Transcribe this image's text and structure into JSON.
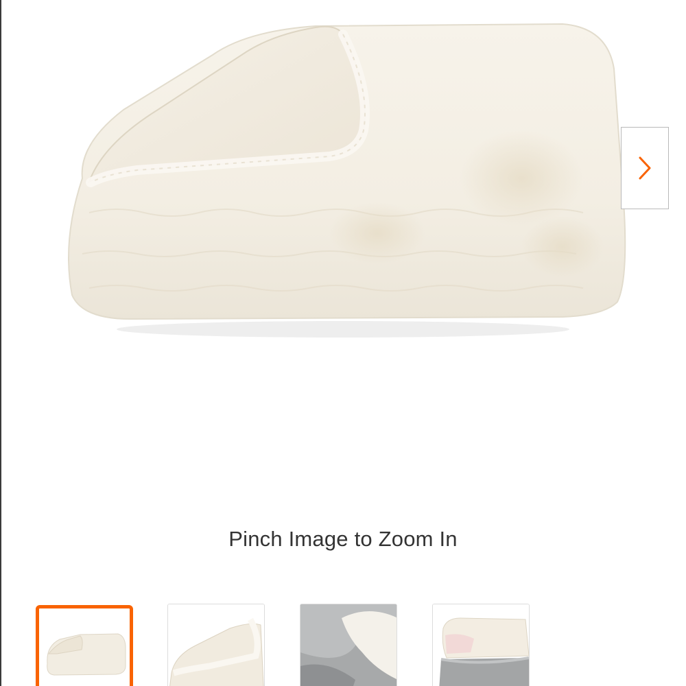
{
  "product_image": {
    "alt_subject": "blanket-image",
    "accent_color": "#f96302"
  },
  "carousel": {
    "next_icon": "chevron-right-icon"
  },
  "zoom_hint": "Pinch Image to Zoom In",
  "thumbnails": [
    {
      "name": "thumbnail-folded-blanket",
      "selected": true
    },
    {
      "name": "thumbnail-blanket-closeup",
      "selected": false
    },
    {
      "name": "thumbnail-blanket-on-gray-throw",
      "selected": false
    },
    {
      "name": "thumbnail-blanket-stacked",
      "selected": false
    }
  ]
}
